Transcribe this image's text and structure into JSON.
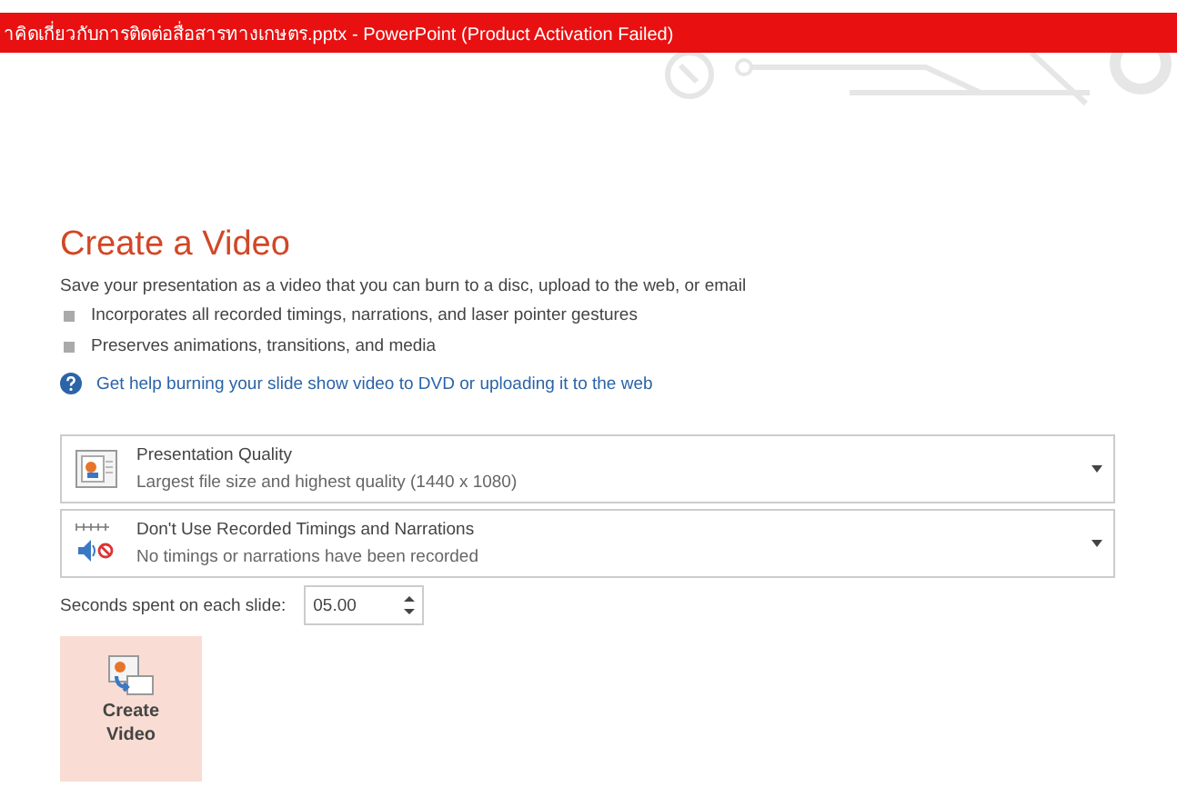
{
  "window": {
    "title": "าคิดเกี่ยวกับการติดต่อสื่อสารทางเกษตร.pptx -  PowerPoint (Product Activation Failed)"
  },
  "heading": "Create a Video",
  "description": "Save your presentation as a video that you can burn to a disc, upload to the web, or email",
  "bullets": [
    "Incorporates all recorded timings, narrations, and laser pointer gestures",
    "Preserves animations, transitions, and media"
  ],
  "help_link": "Get help burning your slide show video to DVD or uploading it to the web",
  "dropdowns": [
    {
      "kind": "quality",
      "title": "Presentation Quality",
      "subtitle": "Largest file size and highest quality (1440 x 1080)"
    },
    {
      "kind": "timings",
      "title": "Don't Use Recorded Timings and Narrations",
      "subtitle": "No timings or narrations have been recorded"
    }
  ],
  "seconds": {
    "label": "Seconds spent on each slide:",
    "value": "05.00"
  },
  "create_button": {
    "line1": "Create",
    "line2": "Video"
  }
}
